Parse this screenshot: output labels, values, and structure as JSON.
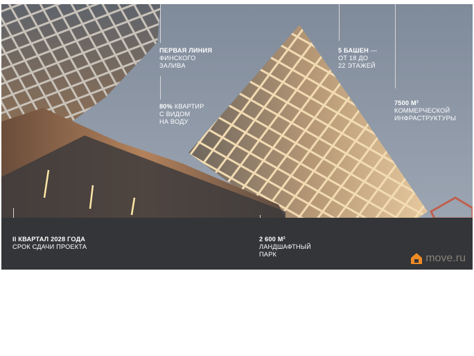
{
  "labels": {
    "first_line": {
      "bold": "Первая линия",
      "lines": [
        "Финского",
        "залива"
      ]
    },
    "water_view": {
      "bold": "80%",
      "first": "квартир",
      "lines": [
        "с видом",
        "на воду"
      ]
    },
    "towers": {
      "bold": "5 башен",
      "suffix": "—",
      "lines": [
        "от 18 до",
        "22 этажей"
      ]
    },
    "commercial": {
      "bold": "7500 м²",
      "lines": [
        "коммерческой",
        "инфраструктуры"
      ]
    },
    "deadline": {
      "bold": "II квартал 2028 года",
      "lines": [
        "срок сдачи проекта"
      ]
    },
    "park": {
      "bold": "2 600 м²",
      "lines": [
        "ландшафтный",
        "парк"
      ]
    }
  },
  "watermark": {
    "text": "move.ru",
    "icon": "house-icon"
  },
  "colors": {
    "sky": "#8e99a8",
    "bar": "#333538",
    "glow": "#f4d9a6",
    "text": "#ffffff"
  }
}
